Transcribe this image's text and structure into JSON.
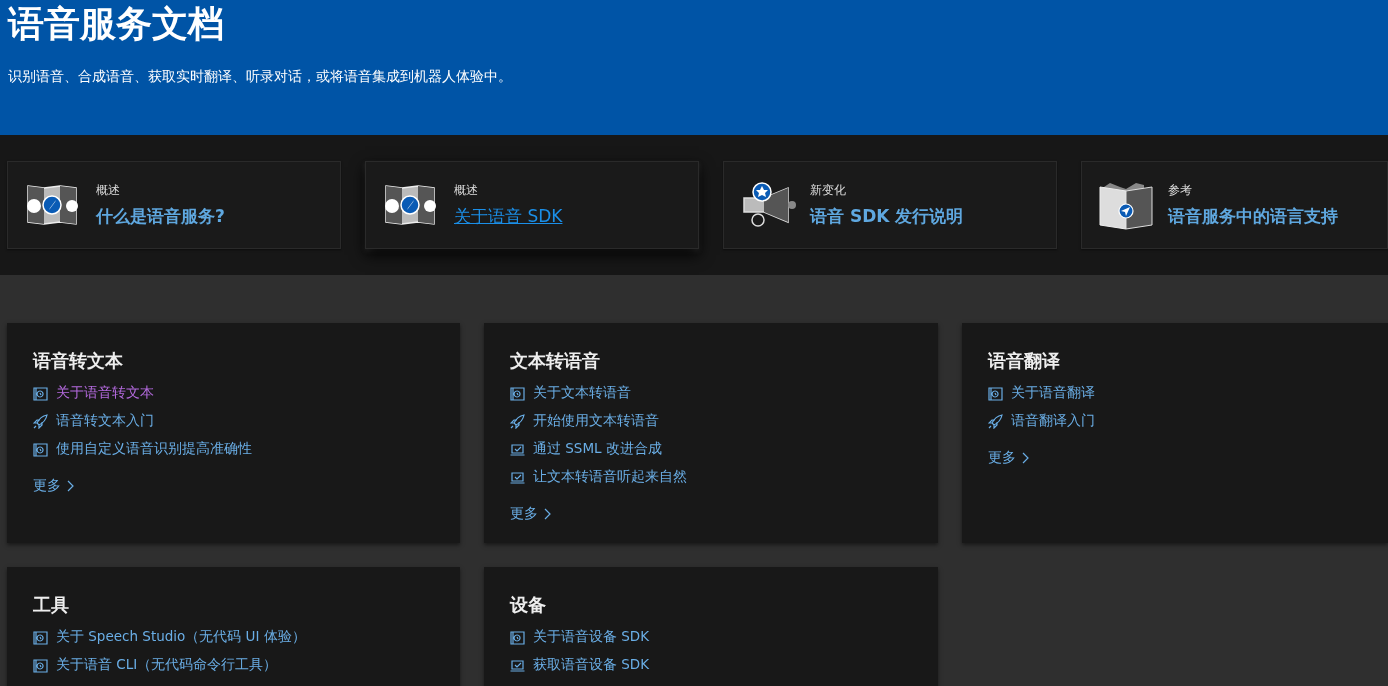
{
  "header": {
    "title": "语音服务文档",
    "subtitle": "识别语音、合成语音、获取实时翻译、听录对话，或将语音集成到机器人体验中。"
  },
  "highlights": [
    {
      "kind": "map",
      "eyebrow": "概述",
      "title": "什么是语音服务?",
      "hovered": false
    },
    {
      "kind": "map",
      "eyebrow": "概述",
      "title": "关于语音 SDK",
      "hovered": true
    },
    {
      "kind": "megaphone",
      "eyebrow": "新变化",
      "title": "语音 SDK 发行说明",
      "hovered": false
    },
    {
      "kind": "book",
      "eyebrow": "参考",
      "title": "语音服务中的语言支持",
      "hovered": false
    }
  ],
  "sections": [
    {
      "title": "语音转文本",
      "more": "更多",
      "links": [
        {
          "kind": "doc",
          "text": "关于语音转文本",
          "visited": true
        },
        {
          "kind": "rocket",
          "text": "语音转文本入门",
          "visited": false
        },
        {
          "kind": "doc",
          "text": "使用自定义语音识别提高准确性",
          "visited": false
        }
      ]
    },
    {
      "title": "文本转语音",
      "more": "更多",
      "links": [
        {
          "kind": "doc",
          "text": "关于文本转语音",
          "visited": false
        },
        {
          "kind": "rocket",
          "text": "开始使用文本转语音",
          "visited": false
        },
        {
          "kind": "tutorial",
          "text": "通过 SSML 改进合成",
          "visited": false
        },
        {
          "kind": "tutorial",
          "text": "让文本转语音听起来自然",
          "visited": false
        }
      ]
    },
    {
      "title": "语音翻译",
      "more": "更多",
      "links": [
        {
          "kind": "doc",
          "text": "关于语音翻译",
          "visited": false
        },
        {
          "kind": "rocket",
          "text": "语音翻译入门",
          "visited": false
        }
      ]
    },
    {
      "title": "工具",
      "links": [
        {
          "kind": "doc",
          "text": "关于 Speech Studio（无代码 UI 体验）",
          "visited": false
        },
        {
          "kind": "doc",
          "text": "关于语音 CLI（无代码命令行工具）",
          "visited": false
        }
      ]
    },
    {
      "title": "设备",
      "links": [
        {
          "kind": "doc",
          "text": "关于语音设备 SDK",
          "visited": false
        },
        {
          "kind": "tutorial",
          "text": "获取语音设备 SDK",
          "visited": false
        }
      ]
    }
  ]
}
